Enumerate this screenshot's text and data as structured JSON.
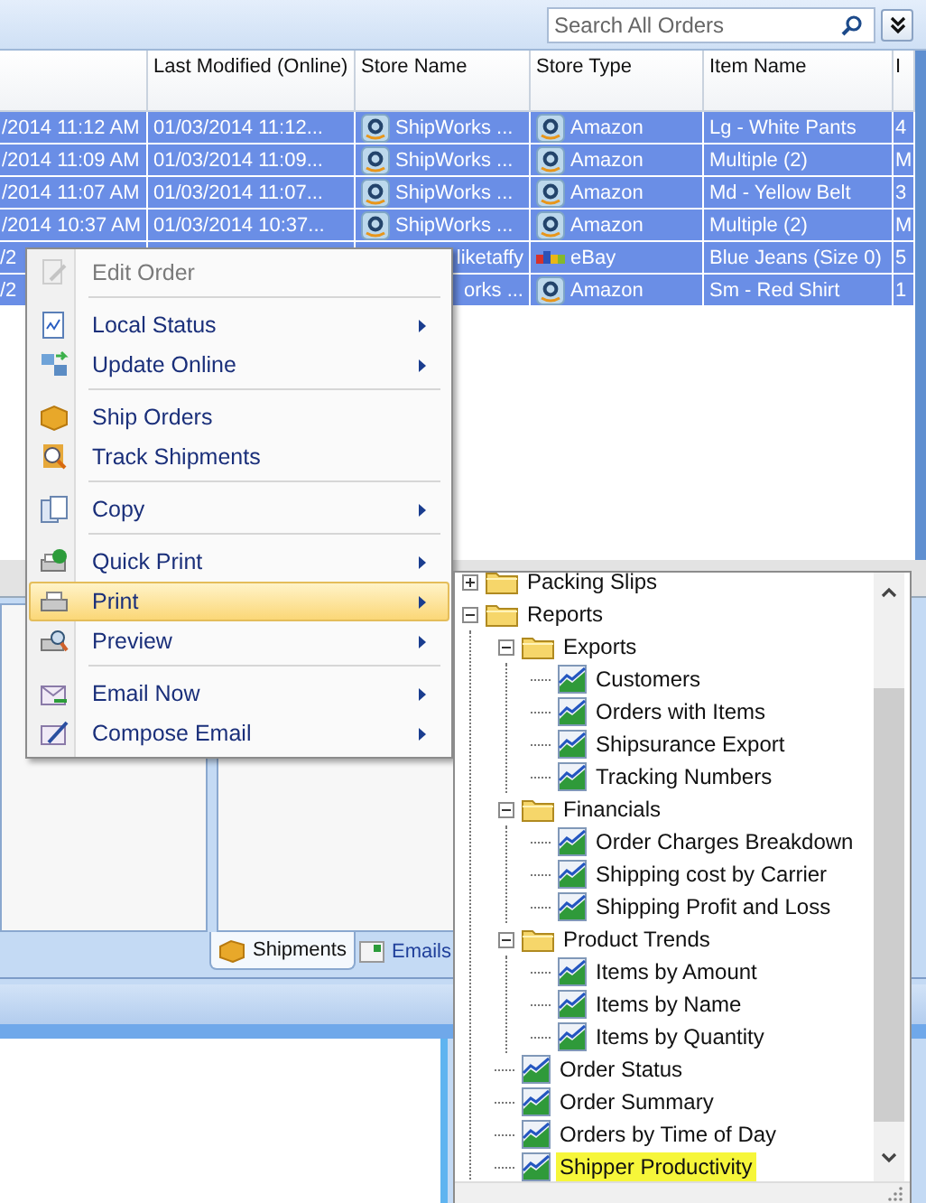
{
  "search": {
    "placeholder": "Search All Orders"
  },
  "table": {
    "columns": [
      "Last Modified (Online)",
      "Store Name",
      "Store Type",
      "Item Name",
      "I"
    ],
    "rows": [
      {
        "selected": true,
        "covered": false,
        "date": "/2014 11:12 AM",
        "last_modified": "01/03/2014 11:12...",
        "store_name": "ShipWorks ...",
        "store_type": {
          "label": "Amazon",
          "kind": "amazon"
        },
        "item_name": "Lg - White Pants",
        "column_6": "4"
      },
      {
        "selected": true,
        "covered": false,
        "date": "/2014 11:09 AM",
        "last_modified": "01/03/2014 11:09...",
        "store_name": "ShipWorks ...",
        "store_type": {
          "label": "Amazon",
          "kind": "amazon"
        },
        "item_name": "Multiple (2)",
        "column_6": "M"
      },
      {
        "selected": true,
        "covered": false,
        "date": "/2014 11:07 AM",
        "last_modified": "01/03/2014 11:07...",
        "store_name": "ShipWorks ...",
        "store_type": {
          "label": "Amazon",
          "kind": "amazon"
        },
        "item_name": "Md - Yellow Belt",
        "column_6": "3"
      },
      {
        "selected": true,
        "covered": false,
        "date": "/2014 10:37 AM",
        "last_modified": "01/03/2014 10:37...",
        "store_name": "ShipWorks ...",
        "store_type": {
          "label": "Amazon",
          "kind": "amazon"
        },
        "item_name": "Multiple (2)",
        "column_6": "M"
      },
      {
        "selected": true,
        "covered": true,
        "date": "/2",
        "store_name": "liketaffy",
        "store_type": {
          "label": "eBay",
          "kind": "ebay"
        },
        "item_name": "Blue Jeans (Size 0)",
        "column_6": "5"
      },
      {
        "selected": true,
        "covered": true,
        "date": "/2",
        "store_name": "orks ...",
        "store_type": {
          "label": "Amazon",
          "kind": "amazon"
        },
        "item_name": "Sm - Red Shirt",
        "column_6": "1"
      }
    ]
  },
  "bottom_tabs": [
    {
      "label": "Shipments",
      "selected": true
    },
    {
      "label": "Emails",
      "selected": false
    }
  ],
  "context_menu": {
    "items": [
      {
        "label": "Edit Order",
        "submenu": false,
        "disabled": true,
        "highlighted": false,
        "separator_after": true
      },
      {
        "label": "Local Status",
        "submenu": true,
        "disabled": false,
        "highlighted": false,
        "separator_after": false
      },
      {
        "label": "Update Online",
        "submenu": true,
        "disabled": false,
        "highlighted": false,
        "separator_after": true
      },
      {
        "label": "Ship Orders",
        "submenu": false,
        "disabled": false,
        "highlighted": false,
        "separator_after": false
      },
      {
        "label": "Track Shipments",
        "submenu": false,
        "disabled": false,
        "highlighted": false,
        "separator_after": true
      },
      {
        "label": "Copy",
        "submenu": true,
        "disabled": false,
        "highlighted": false,
        "separator_after": true
      },
      {
        "label": "Quick Print",
        "submenu": true,
        "disabled": false,
        "highlighted": false,
        "separator_after": false
      },
      {
        "label": "Print",
        "submenu": true,
        "disabled": false,
        "highlighted": true,
        "separator_after": false
      },
      {
        "label": "Preview",
        "submenu": true,
        "disabled": false,
        "highlighted": false,
        "separator_after": true
      },
      {
        "label": "Email Now",
        "submenu": true,
        "disabled": false,
        "highlighted": false,
        "separator_after": false
      },
      {
        "label": "Compose Email",
        "submenu": true,
        "disabled": false,
        "highlighted": false,
        "separator_after": false
      }
    ]
  },
  "print_tree": {
    "items": [
      {
        "label": "Packing Slips",
        "kind": "folder",
        "expanded": false,
        "selected": false
      },
      {
        "label": "Reports",
        "kind": "folder",
        "expanded": true,
        "selected": false,
        "children": [
          {
            "label": "Exports",
            "kind": "folder",
            "expanded": true,
            "selected": false,
            "children": [
              {
                "label": "Customers",
                "kind": "report",
                "selected": false
              },
              {
                "label": "Orders with Items",
                "kind": "report",
                "selected": false
              },
              {
                "label": "Shipsurance Export",
                "kind": "report",
                "selected": false
              },
              {
                "label": "Tracking Numbers",
                "kind": "report",
                "selected": false
              }
            ]
          },
          {
            "label": "Financials",
            "kind": "folder",
            "expanded": true,
            "selected": false,
            "children": [
              {
                "label": "Order Charges Breakdown",
                "kind": "report",
                "selected": false
              },
              {
                "label": "Shipping cost by Carrier",
                "kind": "report",
                "selected": false
              },
              {
                "label": "Shipping Profit and Loss",
                "kind": "report",
                "selected": false
              }
            ]
          },
          {
            "label": "Product Trends",
            "kind": "folder",
            "expanded": true,
            "selected": false,
            "children": [
              {
                "label": "Items by Amount",
                "kind": "report",
                "selected": false
              },
              {
                "label": "Items by Name",
                "kind": "report",
                "selected": false
              },
              {
                "label": "Items by Quantity",
                "kind": "report",
                "selected": false
              }
            ]
          },
          {
            "label": "Order Status",
            "kind": "report",
            "selected": false
          },
          {
            "label": "Order Summary",
            "kind": "report",
            "selected": false
          },
          {
            "label": "Orders by Time of Day",
            "kind": "report",
            "selected": false
          },
          {
            "label": "Shipper Productivity",
            "kind": "report",
            "selected": true
          }
        ]
      }
    ]
  }
}
